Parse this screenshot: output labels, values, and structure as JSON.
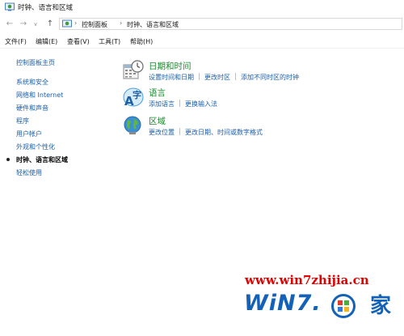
{
  "window": {
    "title": "时钟、语言和区域"
  },
  "address": {
    "crumbs": [
      "控制面板",
      "时钟、语言和区域"
    ]
  },
  "menu": {
    "items": [
      "文件(F)",
      "编辑(E)",
      "查看(V)",
      "工具(T)",
      "帮助(H)"
    ]
  },
  "sidebar": {
    "items": [
      {
        "label": "控制面板主页"
      },
      {
        "label": "系统和安全"
      },
      {
        "label": "网络和 Internet"
      },
      {
        "label": "硬件和声音"
      },
      {
        "label": "程序"
      },
      {
        "label": "用户帐户"
      },
      {
        "label": "外观和个性化"
      },
      {
        "label": "时钟、语言和区域",
        "current": true
      },
      {
        "label": "轻松使用"
      }
    ]
  },
  "categories": [
    {
      "title": "日期和时间",
      "icon": "clock-calendar-icon",
      "links": [
        "设置时间和日期",
        "更改时区",
        "添加不同时区的时钟"
      ]
    },
    {
      "title": "语言",
      "icon": "language-icon",
      "links": [
        "添加语言",
        "更换输入法"
      ]
    },
    {
      "title": "区域",
      "icon": "globe-icon",
      "links": [
        "更改位置",
        "更改日期、时间或数字格式"
      ]
    }
  ],
  "watermark": {
    "url": "www.win7zhijia.cn",
    "brand": "WiN7.",
    "jia": "家"
  },
  "colors": {
    "link": "#1a5ea8",
    "category_title": "#1b8a2e",
    "watermark_red": "#e30000",
    "watermark_blue": "#1462b8"
  }
}
